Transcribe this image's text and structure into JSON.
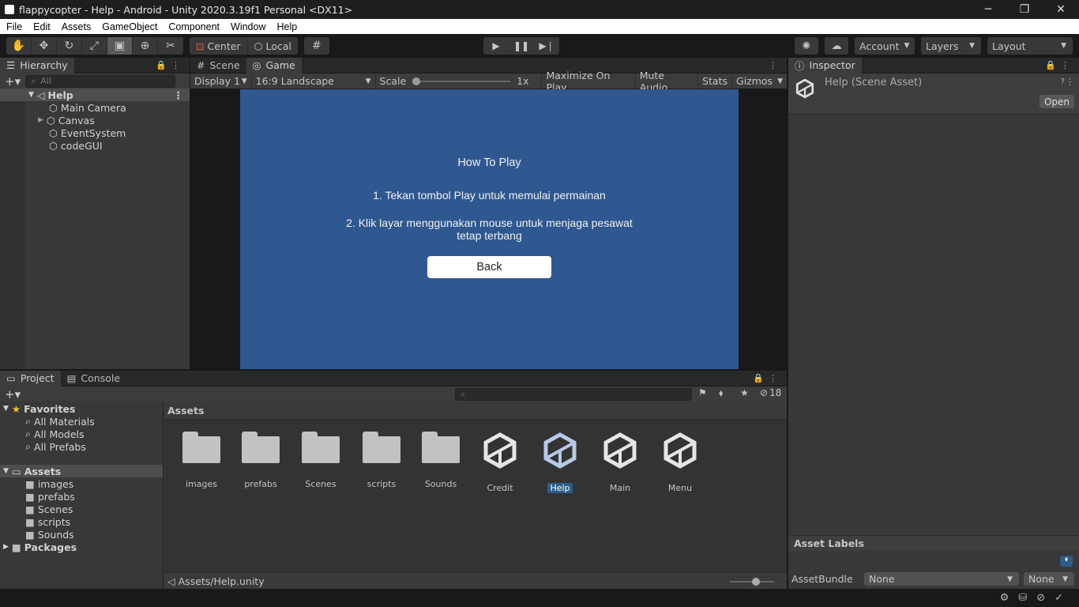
{
  "window": {
    "title": "flappycopter - Help - Android - Unity 2020.3.19f1 Personal <DX11>",
    "minimize": "─",
    "maximize": "❐",
    "close": "✕"
  },
  "menu": [
    "File",
    "Edit",
    "Assets",
    "GameObject",
    "Component",
    "Window",
    "Help"
  ],
  "toolbar": {
    "pivot_label": "Center",
    "space_label": "Local",
    "account_label": "Account",
    "layers_label": "Layers",
    "layout_label": "Layout"
  },
  "hierarchy": {
    "tab_label": "Hierarchy",
    "search_placeholder": "All",
    "scene_name": "Help",
    "items": [
      "Main Camera",
      "Canvas",
      "EventSystem",
      "codeGUI"
    ]
  },
  "scene_tabs": {
    "scene_label": "Scene",
    "game_label": "Game"
  },
  "game_toolbar": {
    "display": "Display 1",
    "aspect": "16:9 Landscape",
    "scale_label": "Scale",
    "scale_value": "1x",
    "maximize": "Maximize On Play",
    "mute": "Mute Audio",
    "stats": "Stats",
    "gizmos": "Gizmos"
  },
  "game": {
    "title": "How To Play",
    "line1": "1. Tekan tombol Play untuk memulai permainan",
    "line2": "2. Klik layar menggunakan mouse untuk menjaga pesawat tetap terbang",
    "back_button": "Back",
    "bg_color": "#2f5890"
  },
  "inspector": {
    "tab_label": "Inspector",
    "asset_title": "Help (Scene Asset)",
    "open_button": "Open",
    "asset_labels": "Asset Labels",
    "assetbundle_label": "AssetBundle",
    "assetbundle_value": "None",
    "assetbundle_variant": "None"
  },
  "project": {
    "tab_project": "Project",
    "tab_console": "Console",
    "hidden_count": "18",
    "favorites_label": "Favorites",
    "favorites": [
      "All Materials",
      "All Models",
      "All Prefabs"
    ],
    "assets_label": "Assets",
    "asset_folders": [
      "images",
      "prefabs",
      "Scenes",
      "scripts",
      "Sounds"
    ],
    "packages_label": "Packages",
    "breadcrumb": "Assets",
    "grid_items": [
      {
        "name": "images",
        "kind": "folder"
      },
      {
        "name": "prefabs",
        "kind": "folder"
      },
      {
        "name": "Scenes",
        "kind": "folder"
      },
      {
        "name": "scripts",
        "kind": "folder"
      },
      {
        "name": "Sounds",
        "kind": "folder"
      },
      {
        "name": "Credit",
        "kind": "scene"
      },
      {
        "name": "Help",
        "kind": "scene",
        "selected": true
      },
      {
        "name": "Main",
        "kind": "scene"
      },
      {
        "name": "Menu",
        "kind": "scene"
      }
    ],
    "path": "Assets/Help.unity"
  },
  "colors": {
    "accent": "#2c5d87",
    "panel": "#383838",
    "dark": "#191919"
  }
}
